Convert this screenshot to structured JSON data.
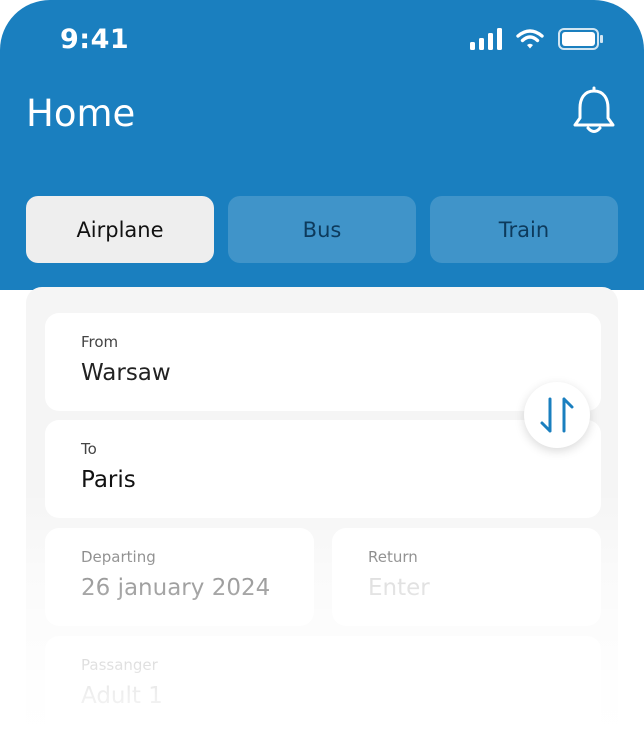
{
  "status_bar": {
    "time": "9:41"
  },
  "header": {
    "title": "Home",
    "notification_icon": "bell-icon"
  },
  "colors": {
    "primary": "#1a7fbf",
    "active_tab": "#eeeeee"
  },
  "tabs": [
    {
      "label": "Airplane",
      "active": true
    },
    {
      "label": "Bus",
      "active": false
    },
    {
      "label": "Train",
      "active": false
    }
  ],
  "form": {
    "from": {
      "label": "From",
      "value": "Warsaw"
    },
    "to": {
      "label": "To",
      "value": "Paris"
    },
    "departing": {
      "label": "Departing",
      "value": "26 january 2024"
    },
    "return": {
      "label": "Return",
      "placeholder": "Enter"
    },
    "passenger": {
      "label": "Passanger",
      "value": "Adult 1"
    },
    "swap_icon": "swap-vertical-icon"
  }
}
